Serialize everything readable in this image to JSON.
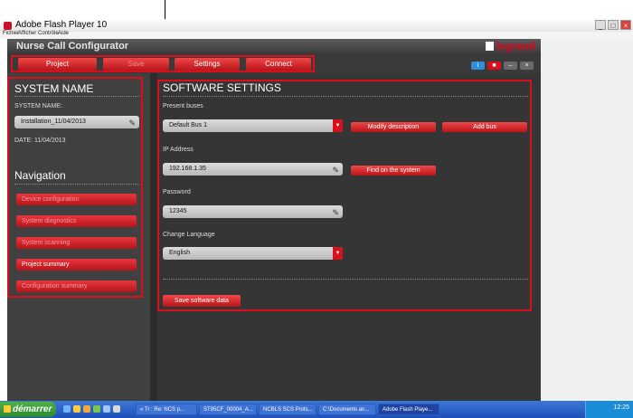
{
  "window": {
    "title": "Adobe Flash Player 10",
    "controls": [
      "_",
      "□",
      "×"
    ]
  },
  "menubar": [
    "Fichier",
    "Afficher",
    "Contrôle",
    "Aide"
  ],
  "app": {
    "title": "Nurse Call Configurator",
    "brand": "legrand"
  },
  "topnav": [
    {
      "label": "Project",
      "disabled": false
    },
    {
      "label": "Save",
      "disabled": true
    },
    {
      "label": "Settings",
      "disabled": false
    },
    {
      "label": "Connect",
      "disabled": false
    }
  ],
  "sidebar": {
    "heading": "SYSTEM NAME",
    "system_name_label": "SYSTEM NAME:",
    "system_name_value": "Installation_11/04/2013",
    "date": "DATE: 11/04/2013",
    "nav_heading": "Navigation",
    "nav_items": [
      {
        "label": "Device configuration",
        "active": false
      },
      {
        "label": "System diagnostics",
        "active": false
      },
      {
        "label": "System scanning",
        "active": false
      },
      {
        "label": "Project summary",
        "active": true
      },
      {
        "label": "Configuration summary",
        "active": false
      }
    ]
  },
  "main": {
    "heading": "SOFTWARE SETTINGS",
    "present_buses_label": "Present buses",
    "present_buses_value": "Default Bus 1",
    "modify_description_button": "Modify description",
    "add_bus_button": "Add bus",
    "ip_label": "IP Address",
    "ip_value": "192.168.1.35",
    "find_button": "Find on the system",
    "password_label": "Password",
    "password_value": "12345",
    "language_label": "Change Language",
    "language_value": "English",
    "save_button": "Save software data"
  },
  "taskbar": {
    "start_label": "démarrer",
    "items": [
      "« Tr : Re: NCS p...",
      "ST95CF_00004_A...",
      "NCBLS SCS Prots...",
      "C:\\Documents an...",
      "Adobe Flash Playe..."
    ],
    "clock": "12:25"
  },
  "colors": {
    "accent_red": "#d9101c",
    "panel_dark": "#2c2c2c",
    "brand_red": "#e2001a"
  }
}
